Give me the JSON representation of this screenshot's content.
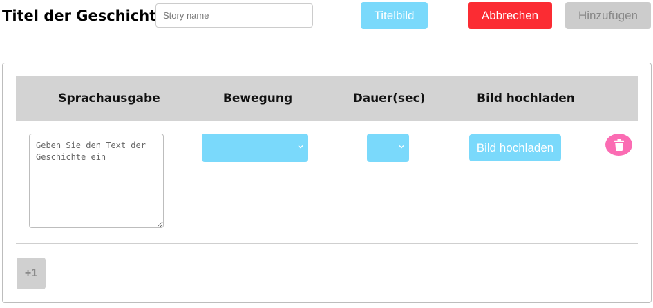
{
  "header": {
    "title": "Titel der Geschichte",
    "story_name_placeholder": "Story name",
    "cover_button": "Titelbild",
    "cancel_button": "Abbrechen",
    "add_button": "Hinzufügen"
  },
  "table": {
    "columns": [
      "Sprachausgabe",
      "Bewegung",
      "Dauer(sec)",
      "Bild hochladen"
    ],
    "rows": [
      {
        "speech_placeholder": "Geben Sie den Text der Geschichte ein",
        "movement_value": "",
        "duration_value": "",
        "upload_button": "Bild hochladen",
        "delete_icon": "trash-icon"
      }
    ]
  },
  "footer": {
    "add_row_button": "+1"
  },
  "colors": {
    "accent": "#7ad9fb",
    "danger": "#fb2c33",
    "disabled": "#cccccc",
    "delete": "#fb6cb3"
  }
}
